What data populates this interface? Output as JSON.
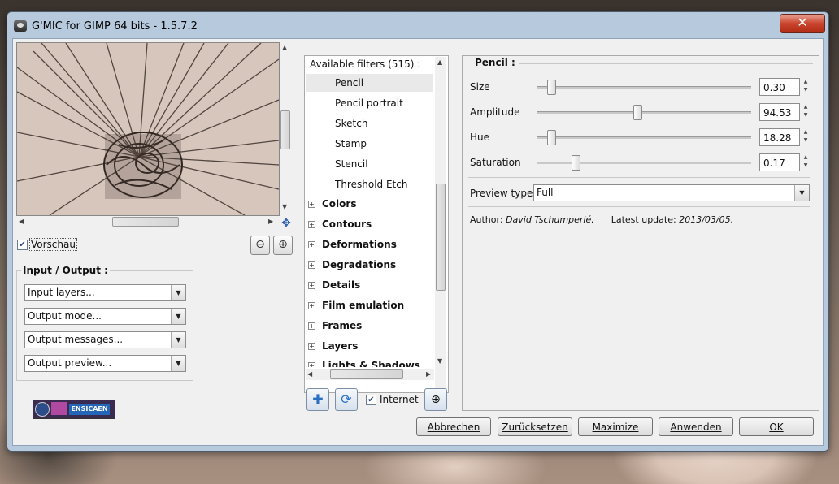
{
  "window": {
    "title": "G'MIC for GIMP 64 bits - 1.5.7.2",
    "close_label": "✕"
  },
  "preview": {
    "checkbox_label": "Vorschau",
    "checked": true
  },
  "io_group": {
    "title": "Input / Output :",
    "combos": [
      {
        "value": "Input layers..."
      },
      {
        "value": "Output mode..."
      },
      {
        "value": "Output messages..."
      },
      {
        "value": "Output preview..."
      }
    ]
  },
  "logo": {
    "text": "ENSICAEN"
  },
  "filters": {
    "header": "Available filters (515) :",
    "items": [
      "Pencil",
      "Pencil portrait",
      "Sketch",
      "Stamp",
      "Stencil",
      "Threshold Etch"
    ],
    "categories": [
      "Colors",
      "Contours",
      "Deformations",
      "Degradations",
      "Details",
      "Film emulation",
      "Frames",
      "Layers",
      "Lights & Shadows"
    ],
    "internet_label": "Internet",
    "internet_checked": true
  },
  "params": {
    "title": "Pencil :",
    "sliders": [
      {
        "label": "Size",
        "value": "0.30",
        "fraction": 0.05
      },
      {
        "label": "Amplitude",
        "value": "94.53",
        "fraction": 0.47
      },
      {
        "label": "Hue",
        "value": "18.28",
        "fraction": 0.05
      },
      {
        "label": "Saturation",
        "value": "0.17",
        "fraction": 0.17
      }
    ],
    "preview_type_label": "Preview type",
    "preview_type_value": "Full",
    "author_prefix": "Author:",
    "author_name": "David Tschumperlé.",
    "update_prefix": "Latest update:",
    "update_date": "2013/03/05."
  },
  "buttons": {
    "cancel": "Abbrechen",
    "reset": "Zurücksetzen",
    "maximize": "Maximize",
    "apply": "Anwenden",
    "ok": "OK"
  }
}
